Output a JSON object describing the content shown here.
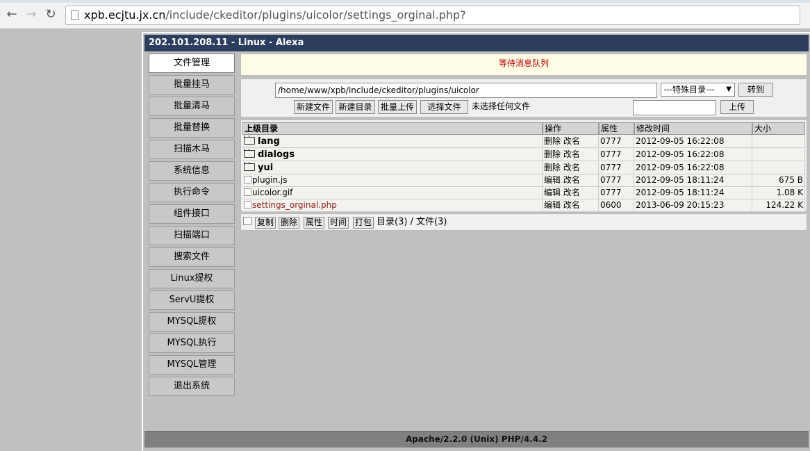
{
  "browser": {
    "url_host": "xpb.ecjtu.jx.cn",
    "url_path": "/include/ckeditor/plugins/uicolor/settings_orginal.php?"
  },
  "panel": {
    "title": "202.101.208.11 - Linux - Alexa"
  },
  "sidebar": {
    "items": [
      {
        "label": "文件管理",
        "active": true
      },
      {
        "label": "批量挂马"
      },
      {
        "label": "批量清马"
      },
      {
        "label": "批量替换"
      },
      {
        "label": "扫描木马"
      },
      {
        "label": "系统信息"
      },
      {
        "label": "执行命令"
      },
      {
        "label": "组件接口"
      },
      {
        "label": "扫描端口"
      },
      {
        "label": "搜索文件"
      },
      {
        "label": "Linux提权"
      },
      {
        "label": "ServU提权"
      },
      {
        "label": "MYSQL提权"
      },
      {
        "label": "MYSQL执行"
      },
      {
        "label": "MYSQL管理"
      },
      {
        "label": "退出系统"
      }
    ]
  },
  "status": {
    "message": "等待消息队列"
  },
  "toolbar": {
    "path": "/home/www/xpb/include/ckeditor/plugins/uicolor",
    "special_dir": "---特殊目录---",
    "goto_label": "转到",
    "new_file": "新建文件",
    "new_dir": "新建目录",
    "batch_upload": "批量上传",
    "choose_file": "选择文件",
    "no_file": "未选择任何文件",
    "upload": "上传"
  },
  "table": {
    "headers": {
      "name": "上级目录",
      "op": "操作",
      "perm": "属性",
      "time": "修改时间",
      "size": "大小"
    },
    "rows": [
      {
        "type": "dir",
        "name": "lang",
        "op": "删除 改名",
        "perm": "0777",
        "time": "2012-09-05 16:22:08",
        "size": ""
      },
      {
        "type": "dir",
        "name": "dialogs",
        "op": "删除 改名",
        "perm": "0777",
        "time": "2012-09-05 16:22:08",
        "size": ""
      },
      {
        "type": "dir",
        "name": "yui",
        "op": "删除 改名",
        "perm": "0777",
        "time": "2012-09-05 16:22:08",
        "size": ""
      },
      {
        "type": "file",
        "name": "plugin.js",
        "op": "编辑 改名",
        "perm": "0777",
        "time": "2012-09-05 18:11:24",
        "size": "675 B"
      },
      {
        "type": "file",
        "name": "uicolor.gif",
        "op": "编辑 改名",
        "perm": "0777",
        "time": "2012-09-05 18:11:24",
        "size": "1.08 K"
      },
      {
        "type": "file",
        "name": "settings_orginal.php",
        "op": "编辑 改名",
        "perm": "0600",
        "time": "2013-06-09 20:15:23",
        "size": "124.22 K"
      }
    ]
  },
  "actions": {
    "copy": "复制",
    "delete": "删除",
    "attr": "属性",
    "time": "时间",
    "pack": "打包",
    "summary": "目录(3) / 文件(3)"
  },
  "footer": {
    "text": "Apache/2.2.0 (Unix) PHP/4.4.2"
  }
}
